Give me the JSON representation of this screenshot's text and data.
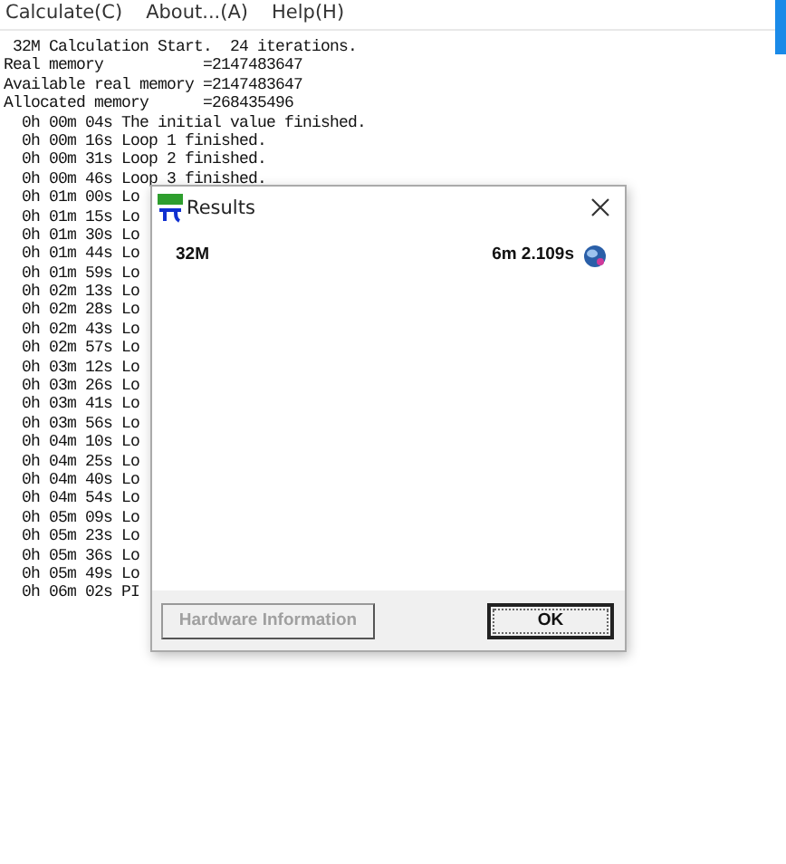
{
  "menu": [
    "Calculate(C)",
    "About...(A)",
    "Help(H)"
  ],
  "log": [
    " 32M Calculation Start.  24 iterations.",
    "Real memory           =2147483647",
    "Available real memory =2147483647",
    "Allocated memory      =268435496",
    "  0h 00m 04s The initial value finished.",
    "  0h 00m 16s Loop 1 finished.",
    "  0h 00m 31s Loop 2 finished.",
    "  0h 00m 46s Loop 3 finished.",
    "  0h 01m 00s Lo",
    "  0h 01m 15s Lo",
    "  0h 01m 30s Lo",
    "  0h 01m 44s Lo",
    "  0h 01m 59s Lo",
    "  0h 02m 13s Lo",
    "  0h 02m 28s Lo",
    "  0h 02m 43s Lo",
    "  0h 02m 57s Lo",
    "  0h 03m 12s Lo",
    "  0h 03m 26s Lo",
    "  0h 03m 41s Lo",
    "  0h 03m 56s Lo",
    "  0h 04m 10s Lo",
    "  0h 04m 25s Lo",
    "  0h 04m 40s Lo",
    "  0h 04m 54s Lo",
    "  0h 05m 09s Lo",
    "  0h 05m 23s Lo",
    "  0h 05m 36s Lo",
    "  0h 05m 49s Lo",
    "  0h 06m 02s PI"
  ],
  "dialog": {
    "title": "Results",
    "size": "32M",
    "time": "6m 2.109s",
    "buttons": [
      {
        "label": "Hardware Information",
        "disabled": true,
        "default": false
      },
      {
        "label": "OK",
        "disabled": false,
        "default": true
      }
    ]
  }
}
